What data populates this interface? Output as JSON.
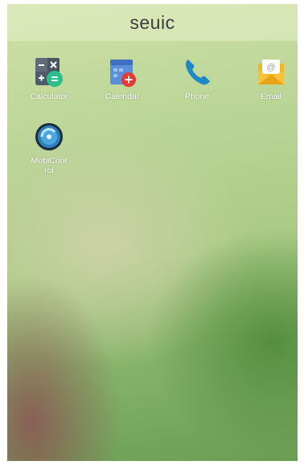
{
  "header": {
    "title": "seuic"
  },
  "apps": [
    {
      "label": "Calculator",
      "icon": "calculator-icon"
    },
    {
      "label": "Calendar",
      "icon": "calendar-icon"
    },
    {
      "label": "Phone",
      "icon": "phone-icon"
    },
    {
      "label": "Email",
      "icon": "email-icon"
    },
    {
      "label_line1": "MobiCont",
      "label_line2": "rol",
      "icon": "mobicontrol-icon"
    }
  ]
}
